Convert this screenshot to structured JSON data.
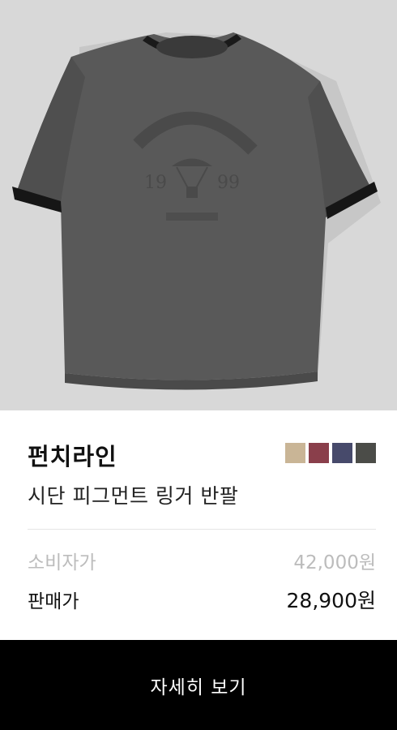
{
  "product": {
    "brand": "펀치라인",
    "name": "시단 피그먼트 링거 반팔",
    "image_icon": "tshirt-photo",
    "swatches": [
      "#c9b596",
      "#8a3f4b",
      "#474a6b",
      "#4b4c48"
    ]
  },
  "prices": {
    "consumer_label": "소비자가",
    "consumer_value": "42,000원",
    "sale_label": "판매가",
    "sale_value": "28,900원"
  },
  "actions": {
    "detail_label": "자세히 보기"
  }
}
